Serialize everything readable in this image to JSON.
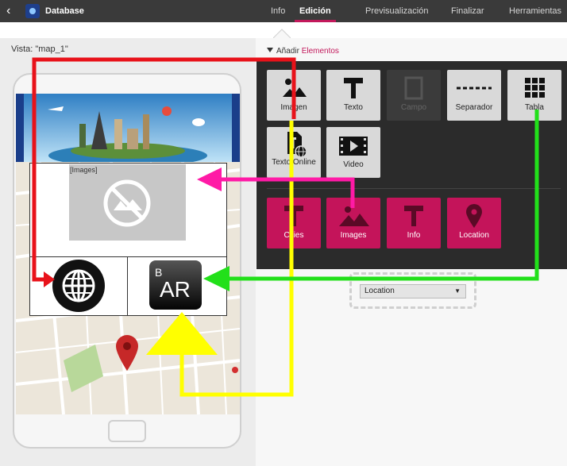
{
  "app": {
    "title": "Database"
  },
  "tabs": [
    {
      "label": "Info",
      "active": false
    },
    {
      "label": "Edición",
      "active": true
    },
    {
      "label": "Previsualización",
      "active": false
    },
    {
      "label": "Finalizar",
      "active": false
    },
    {
      "label": "Herramientas",
      "active": false
    }
  ],
  "view": {
    "label": "Vista: \"map_1\""
  },
  "add_elements": {
    "prefix": "Añadir",
    "highlight": "Elementos"
  },
  "elements": [
    {
      "label": "Imagen",
      "icon": "image-icon",
      "enabled": true
    },
    {
      "label": "Texto",
      "icon": "text-icon",
      "enabled": true
    },
    {
      "label": "Campo",
      "icon": "field-icon",
      "enabled": false
    },
    {
      "label": "Separador",
      "icon": "separator-icon",
      "enabled": true
    },
    {
      "label": "Tabla",
      "icon": "table-icon",
      "enabled": true
    },
    {
      "label": "Texto Online",
      "icon": "online-text-icon",
      "enabled": true
    },
    {
      "label": "Video",
      "icon": "video-icon",
      "enabled": true
    }
  ],
  "fields": [
    {
      "label": "Cities",
      "icon": "text-icon"
    },
    {
      "label": "Images",
      "icon": "image-icon"
    },
    {
      "label": "Info",
      "icon": "text-icon"
    },
    {
      "label": "Location",
      "icon": "location-pin-icon"
    }
  ],
  "preview": {
    "image_placeholder_label": "[Images]",
    "ar_label": "AR",
    "ar_superscript": "B"
  },
  "select": {
    "value": "Location"
  },
  "colors": {
    "accent": "#c2185b",
    "field_tile": "#c4145a",
    "arrow_red": "#e8121a",
    "arrow_yellow": "#ffff00",
    "arrow_green": "#22e01a",
    "arrow_magenta": "#ff1aa6"
  }
}
